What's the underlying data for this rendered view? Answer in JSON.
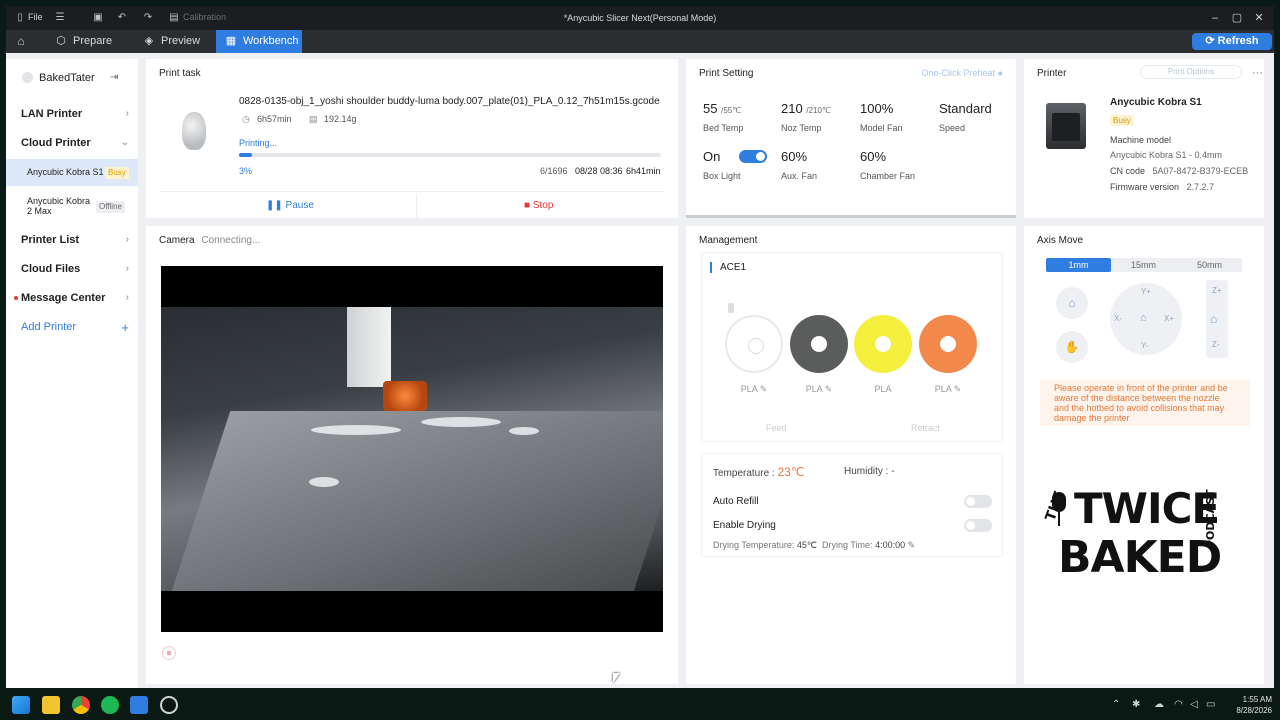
{
  "titlebar": {
    "file_label": "File",
    "calibration_label": "Calibration",
    "window_title": "*Anycubic Slicer Next(Personal Mode)"
  },
  "nav": {
    "tabs": [
      {
        "label": "Prepare",
        "icon": "cube-icon"
      },
      {
        "label": "Preview",
        "icon": "layers-icon"
      },
      {
        "label": "Workbench",
        "icon": "grid-icon"
      }
    ],
    "active_tab": "Workbench",
    "refresh_label": "Refresh"
  },
  "sidebar": {
    "user_name": "BakedTater",
    "lan_printer": "LAN Printer",
    "cloud_printer": "Cloud Printer",
    "devices": [
      {
        "name": "Anycubic Kobra S1",
        "status": "Busy"
      },
      {
        "name": "Anycubic Kobra 2 Max",
        "status": "Offline"
      }
    ],
    "printer_list": "Printer List",
    "cloud_files": "Cloud Files",
    "message_center": "Message Center",
    "add_printer": "Add Printer"
  },
  "print_task": {
    "title": "Print task",
    "file_name": "0828-0135-obj_1_yoshi shoulder buddy-luma body.007_plate(01)_PLA_0.12_7h51m15s.gcode",
    "duration": "6h57min",
    "weight": "192.14g",
    "status_text": "Printing...",
    "progress_label": "3%",
    "progress": 0.03,
    "layers": "6/1696",
    "finish_time": "08/28 08:36",
    "remaining": "6h41min",
    "pause_label": "Pause",
    "stop_label": "Stop"
  },
  "camera": {
    "title": "Camera",
    "status": "Connecting..."
  },
  "print_setting": {
    "title": "Print Setting",
    "one_click": "One-Click Preheat",
    "bed_temp": "55",
    "bed_target": "/55℃",
    "bed_label": "Bed Temp",
    "noz_temp": "210",
    "noz_target": "/210℃",
    "noz_label": "Noz Temp",
    "model_fan": "100%",
    "model_fan_label": "Model Fan",
    "speed": "Standard",
    "speed_label": "Speed",
    "box_light": "On",
    "box_light_label": "Box Light",
    "aux_fan": "60%",
    "aux_fan_label": "Aux. Fan",
    "chamber_fan": "60%",
    "chamber_fan_label": "Chamber Fan"
  },
  "printer": {
    "title": "Printer",
    "options_label": "Print Options",
    "name": "Anycubic Kobra S1",
    "status": "Busy",
    "machine_model_label": "Machine model",
    "machine_model": "Anycubic Kobra S1 - 0.4mm",
    "cn_code_label": "CN code",
    "cn_code": "5A07-8472-B379-ECEB",
    "firmware_label": "Firmware version",
    "firmware": "2.7.2.7"
  },
  "management": {
    "title": "Management",
    "ace_label": "ACE1",
    "spools": [
      {
        "type": "PLA",
        "color": "#ffffff"
      },
      {
        "type": "PLA",
        "color": "#5a5d5c"
      },
      {
        "type": "PLA",
        "color": "#f3ef3c"
      },
      {
        "type": "PLA",
        "color": "#f2884a"
      }
    ],
    "feed_label": "Feed",
    "retract_label": "Retract",
    "temperature_label": "Temperature :",
    "temperature": "23℃",
    "humidity_label": "Humidity :",
    "humidity": "-",
    "auto_refill": "Auto Refill",
    "enable_drying": "Enable Drying",
    "drying_temp_label": "Drying Temperature:",
    "drying_temp": "45℃",
    "drying_time_label": "Drying Time:",
    "drying_time": "4:00:00"
  },
  "axis": {
    "title": "Axis Move",
    "steps": [
      "1mm",
      "15mm",
      "50mm"
    ],
    "active_step": "1mm",
    "y_plus": "Y+",
    "y_minus": "Y-",
    "x_plus": "X+",
    "x_minus": "X-",
    "z_plus": "Z+",
    "z_minus": "Z-",
    "warning": "Please operate in front of the printer and be aware of the distance between the nozzle and the hotbed to avoid collisions that may damage the printer"
  },
  "logo": {
    "the": "THE",
    "twice": "TWICE",
    "baked": "BAKED",
    "podcast": "PODCAST"
  },
  "taskbar": {
    "time": "1:55 AM",
    "date": "8/28/2026"
  },
  "colors": {
    "accent": "#2f7de1",
    "busy": "#d69b00",
    "stop": "#e53935",
    "temp_orange": "#e07a3a"
  }
}
